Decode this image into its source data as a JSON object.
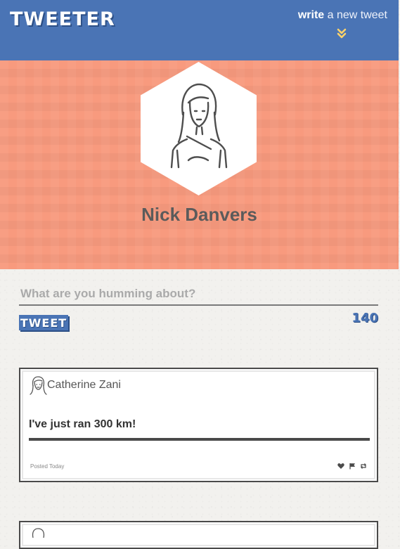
{
  "app": {
    "logo": "TWEETER",
    "write_strong": "write",
    "write_rest": " a new tweet"
  },
  "profile": {
    "name": "Nick Danvers"
  },
  "compose": {
    "placeholder": "What are you humming about?",
    "value": "",
    "button_label": "TWEET",
    "char_count": "140"
  },
  "tweets": [
    {
      "author": "Catherine Zani",
      "text": "I've just ran 300 km!",
      "posted": "Posted Today",
      "actions": [
        "heart-icon",
        "flag-icon",
        "retweet-icon"
      ]
    }
  ],
  "colors": {
    "primary": "#4a74b5",
    "hero": "#f89a7e",
    "text": "#5b5b5b"
  }
}
